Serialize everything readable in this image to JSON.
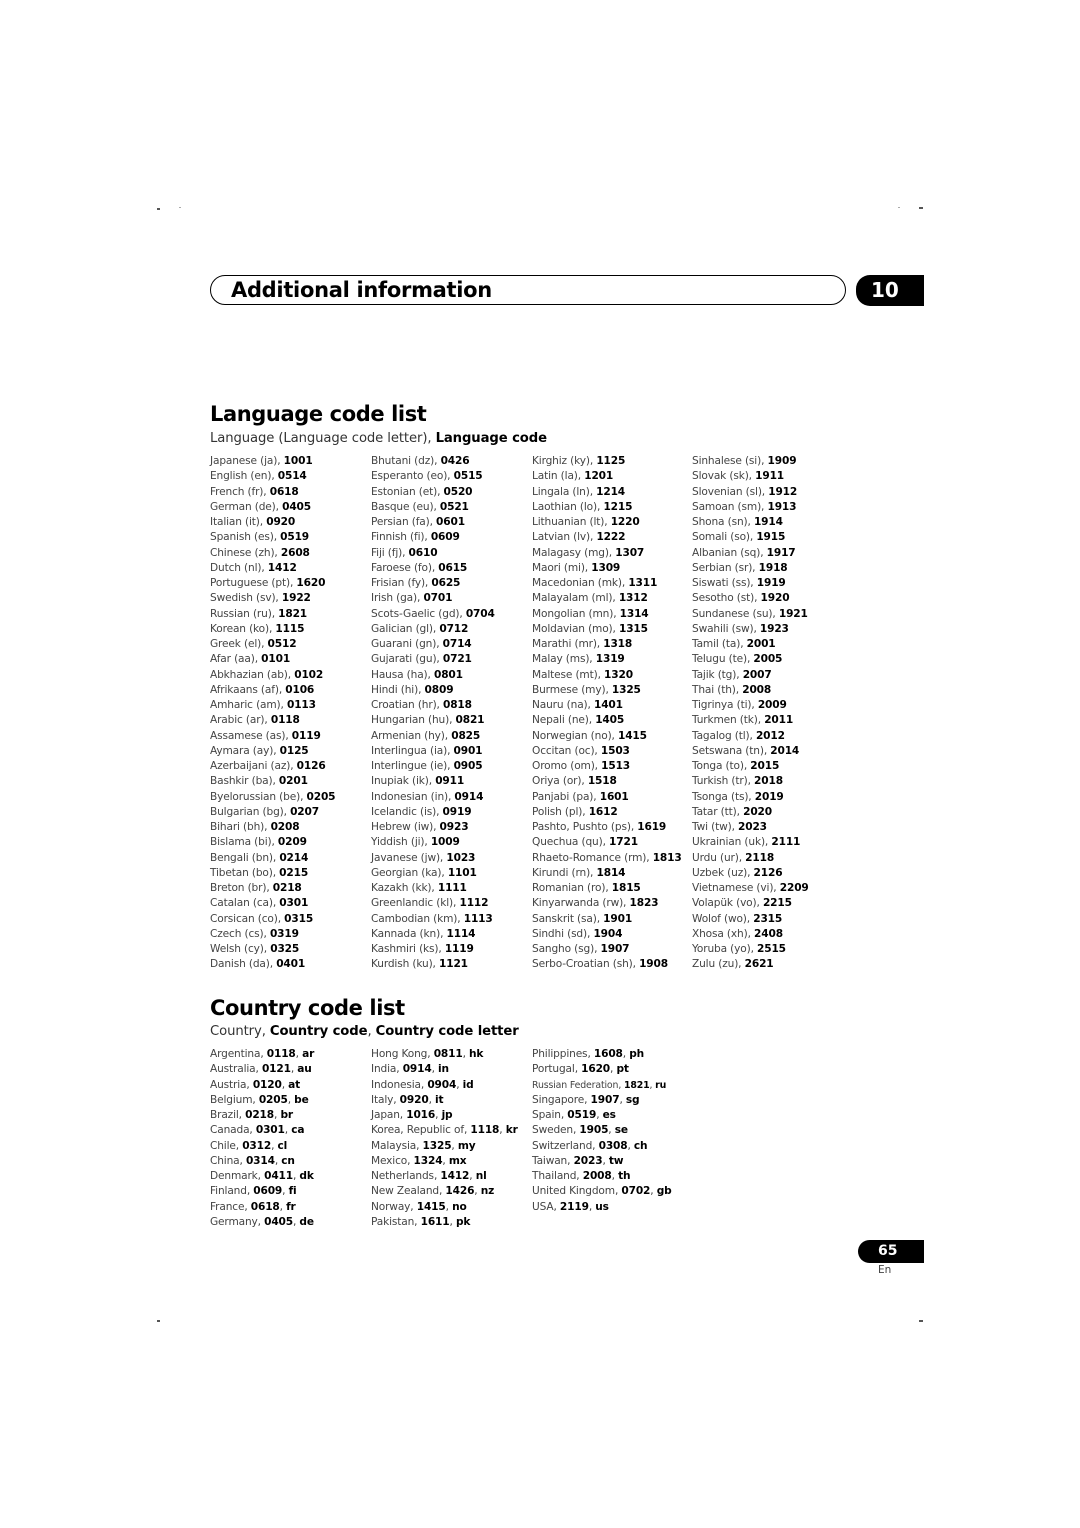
{
  "header": {
    "title": "Additional information",
    "chapter": "10"
  },
  "language_section": {
    "title": "Language code list",
    "subtitle_plain": "Language (Language code letter), ",
    "subtitle_bold": "Language code",
    "columns": [
      [
        [
          "Japanese (ja), ",
          "1001"
        ],
        [
          "English (en), ",
          "0514"
        ],
        [
          "French (fr), ",
          "0618"
        ],
        [
          "German (de), ",
          "0405"
        ],
        [
          "Italian (it), ",
          "0920"
        ],
        [
          "Spanish (es), ",
          "0519"
        ],
        [
          "Chinese (zh), ",
          "2608"
        ],
        [
          "Dutch (nl), ",
          "1412"
        ],
        [
          "Portuguese (pt), ",
          "1620"
        ],
        [
          "Swedish (sv), ",
          "1922"
        ],
        [
          "Russian (ru), ",
          "1821"
        ],
        [
          "Korean (ko), ",
          "1115"
        ],
        [
          "Greek (el), ",
          "0512"
        ],
        [
          "Afar (aa), ",
          "0101"
        ],
        [
          "Abkhazian (ab), ",
          "0102"
        ],
        [
          "Afrikaans (af), ",
          "0106"
        ],
        [
          "Amharic (am), ",
          "0113"
        ],
        [
          "Arabic (ar), ",
          "0118"
        ],
        [
          "Assamese (as), ",
          "0119"
        ],
        [
          "Aymara (ay), ",
          "0125"
        ],
        [
          "Azerbaijani (az), ",
          "0126"
        ],
        [
          "Bashkir (ba), ",
          "0201"
        ],
        [
          "Byelorussian (be), ",
          "0205"
        ],
        [
          "Bulgarian (bg), ",
          "0207"
        ],
        [
          "Bihari (bh), ",
          "0208"
        ],
        [
          "Bislama (bi), ",
          "0209"
        ],
        [
          "Bengali (bn), ",
          "0214"
        ],
        [
          "Tibetan (bo), ",
          "0215"
        ],
        [
          "Breton (br), ",
          "0218"
        ],
        [
          "Catalan (ca), ",
          "0301"
        ],
        [
          "Corsican (co), ",
          "0315"
        ],
        [
          "Czech (cs), ",
          "0319"
        ],
        [
          "Welsh (cy), ",
          "0325"
        ],
        [
          "Danish (da), ",
          "0401"
        ]
      ],
      [
        [
          "Bhutani (dz), ",
          "0426"
        ],
        [
          "Esperanto (eo), ",
          "0515"
        ],
        [
          "Estonian (et), ",
          "0520"
        ],
        [
          "Basque (eu), ",
          "0521"
        ],
        [
          "Persian (fa), ",
          "0601"
        ],
        [
          "Finnish (fi), ",
          "0609"
        ],
        [
          "Fiji (fj), ",
          "0610"
        ],
        [
          "Faroese (fo), ",
          "0615"
        ],
        [
          "Frisian (fy), ",
          "0625"
        ],
        [
          "Irish (ga), ",
          "0701"
        ],
        [
          "Scots-Gaelic (gd), ",
          "0704"
        ],
        [
          "Galician (gl), ",
          "0712"
        ],
        [
          "Guarani (gn), ",
          "0714"
        ],
        [
          "Gujarati (gu), ",
          "0721"
        ],
        [
          "Hausa (ha), ",
          "0801"
        ],
        [
          "Hindi (hi), ",
          "0809"
        ],
        [
          "Croatian (hr), ",
          "0818"
        ],
        [
          "Hungarian (hu), ",
          "0821"
        ],
        [
          "Armenian (hy), ",
          "0825"
        ],
        [
          "Interlingua (ia), ",
          "0901"
        ],
        [
          "Interlingue (ie), ",
          "0905"
        ],
        [
          "Inupiak (ik), ",
          "0911"
        ],
        [
          "Indonesian (in), ",
          "0914"
        ],
        [
          "Icelandic (is), ",
          "0919"
        ],
        [
          "Hebrew (iw), ",
          "0923"
        ],
        [
          "Yiddish (ji), ",
          "1009"
        ],
        [
          "Javanese (jw), ",
          "1023"
        ],
        [
          "Georgian (ka), ",
          "1101"
        ],
        [
          "Kazakh (kk), ",
          "1111"
        ],
        [
          "Greenlandic  (kl), ",
          "1112"
        ],
        [
          "Cambodian (km), ",
          "1113"
        ],
        [
          "Kannada (kn), ",
          "1114"
        ],
        [
          "Kashmiri (ks), ",
          "1119"
        ],
        [
          "Kurdish (ku), ",
          "1121"
        ]
      ],
      [
        [
          "Kirghiz (ky), ",
          "1125"
        ],
        [
          "Latin (la), ",
          "1201"
        ],
        [
          "Lingala (ln), ",
          "1214"
        ],
        [
          "Laothian (lo), ",
          "1215"
        ],
        [
          "Lithuanian (lt), ",
          "1220"
        ],
        [
          "Latvian (lv), ",
          "1222"
        ],
        [
          "Malagasy (mg), ",
          "1307"
        ],
        [
          "Maori (mi), ",
          "1309"
        ],
        [
          "Macedonian (mk), ",
          "1311"
        ],
        [
          "Malayalam  (ml), ",
          "1312"
        ],
        [
          "Mongolian (mn), ",
          "1314"
        ],
        [
          "Moldavian (mo), ",
          "1315"
        ],
        [
          "Marathi (mr), ",
          "1318"
        ],
        [
          "Malay  (ms), ",
          "1319"
        ],
        [
          "Maltese (mt), ",
          "1320"
        ],
        [
          "Burmese (my), ",
          "1325"
        ],
        [
          "Nauru (na), ",
          "1401"
        ],
        [
          "Nepali (ne), ",
          "1405"
        ],
        [
          "Norwegian (no), ",
          "1415"
        ],
        [
          "Occitan (oc), ",
          "1503"
        ],
        [
          "Oromo (om), ",
          "1513"
        ],
        [
          "Oriya (or), ",
          "1518"
        ],
        [
          "Panjabi (pa), ",
          "1601"
        ],
        [
          "Polish (pl), ",
          "1612"
        ],
        [
          "Pashto, Pushto (ps), ",
          "1619"
        ],
        [
          "Quechua (qu), ",
          "1721"
        ],
        [
          "Rhaeto-Romance (rm), ",
          "1813"
        ],
        [
          "Kirundi (rn), ",
          "1814"
        ],
        [
          "Romanian (ro), ",
          "1815"
        ],
        [
          "Kinyarwanda (rw), ",
          "1823"
        ],
        [
          "Sanskrit (sa), ",
          "1901"
        ],
        [
          "Sindhi (sd), ",
          "1904"
        ],
        [
          "Sangho (sg), ",
          "1907"
        ],
        [
          "Serbo-Croatian (sh), ",
          "1908"
        ]
      ],
      [
        [
          "Sinhalese (si), ",
          "1909"
        ],
        [
          "Slovak (sk), ",
          "1911"
        ],
        [
          "Slovenian (sl), ",
          "1912"
        ],
        [
          "Samoan (sm), ",
          "1913"
        ],
        [
          "Shona (sn), ",
          "1914"
        ],
        [
          "Somali (so), ",
          "1915"
        ],
        [
          "Albanian (sq), ",
          "1917"
        ],
        [
          "Serbian (sr), ",
          "1918"
        ],
        [
          "Siswati (ss), ",
          "1919"
        ],
        [
          "Sesotho (st), ",
          "1920"
        ],
        [
          "Sundanese (su), ",
          "1921"
        ],
        [
          "Swahili (sw), ",
          "1923"
        ],
        [
          "Tamil (ta), ",
          "2001"
        ],
        [
          "Telugu (te), ",
          "2005"
        ],
        [
          "Tajik (tg), ",
          "2007"
        ],
        [
          "Thai (th), ",
          "2008"
        ],
        [
          "Tigrinya (ti), ",
          "2009"
        ],
        [
          "Turkmen (tk), ",
          "2011"
        ],
        [
          "Tagalog (tl), ",
          "2012"
        ],
        [
          "Setswana (tn), ",
          "2014"
        ],
        [
          "Tonga (to), ",
          "2015"
        ],
        [
          "Turkish (tr), ",
          "2018"
        ],
        [
          "Tsonga (ts), ",
          "2019"
        ],
        [
          "Tatar (tt), ",
          "2020"
        ],
        [
          "Twi (tw), ",
          "2023"
        ],
        [
          "Ukrainian (uk), ",
          "2111"
        ],
        [
          "Urdu (ur), ",
          "2118"
        ],
        [
          "Uzbek (uz), ",
          "2126"
        ],
        [
          "Vietnamese (vi), ",
          "2209"
        ],
        [
          "Volapük (vo), ",
          "2215"
        ],
        [
          "Wolof (wo), ",
          "2315"
        ],
        [
          "Xhosa (xh), ",
          "2408"
        ],
        [
          "Yoruba (yo), ",
          "2515"
        ],
        [
          "Zulu (zu), ",
          "2621"
        ]
      ]
    ]
  },
  "country_section": {
    "title": "Country code list",
    "subtitle_plain": "Country, ",
    "subtitle_bold1": "Country code",
    "subtitle_sep": ", ",
    "subtitle_bold2": "Country code letter",
    "columns": [
      [
        [
          "Argentina",
          "0118",
          "ar"
        ],
        [
          "Australia",
          "0121",
          "au"
        ],
        [
          "Austria",
          "0120",
          "at"
        ],
        [
          "Belgium",
          "0205",
          "be"
        ],
        [
          "Brazil",
          "0218",
          "br"
        ],
        [
          "Canada",
          "0301",
          "ca"
        ],
        [
          "Chile",
          "0312",
          "cl"
        ],
        [
          "China",
          "0314",
          "cn"
        ],
        [
          "Denmark",
          "0411",
          "dk"
        ],
        [
          "Finland",
          "0609",
          "fi"
        ],
        [
          "France",
          "0618",
          "fr"
        ],
        [
          "Germany",
          "0405",
          "de"
        ]
      ],
      [
        [
          "Hong Kong",
          "0811",
          "hk"
        ],
        [
          "India",
          "0914",
          "in"
        ],
        [
          "Indonesia",
          "0904",
          "id"
        ],
        [
          "Italy",
          "0920",
          "it"
        ],
        [
          "Japan",
          "1016",
          "jp"
        ],
        [
          "Korea, Republic of",
          "1118",
          "kr"
        ],
        [
          "Malaysia",
          "1325",
          "my"
        ],
        [
          "Mexico",
          "1324",
          "mx"
        ],
        [
          "Netherlands",
          "1412",
          "nl"
        ],
        [
          "New Zealand",
          "1426",
          "nz"
        ],
        [
          "Norway",
          "1415",
          "no"
        ],
        [
          "Pakistan",
          "1611",
          "pk"
        ]
      ],
      [
        [
          "Philippines",
          "1608",
          "ph"
        ],
        [
          "Portugal",
          "1620",
          "pt"
        ],
        [
          "Russian Federation",
          "1821",
          "ru"
        ],
        [
          "Singapore",
          "1907",
          "sg"
        ],
        [
          "Spain",
          "0519",
          "es"
        ],
        [
          "Sweden",
          "1905",
          "se"
        ],
        [
          "Switzerland",
          "0308",
          "ch"
        ],
        [
          "Taiwan",
          "2023",
          "tw"
        ],
        [
          "Thailand",
          "2008",
          "th"
        ],
        [
          "United Kingdom",
          "0702",
          "gb"
        ],
        [
          "USA",
          "2119",
          "us"
        ]
      ]
    ]
  },
  "footer": {
    "page_number": "65",
    "language": "En"
  }
}
